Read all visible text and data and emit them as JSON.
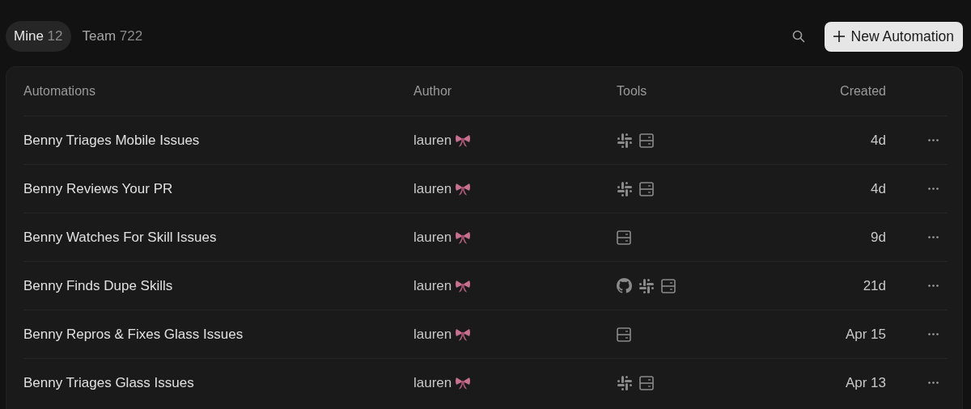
{
  "tabs": [
    {
      "label": "Mine",
      "count": "12",
      "selected": true
    },
    {
      "label": "Team",
      "count": "722",
      "selected": false
    }
  ],
  "new_button": {
    "label": "New Automation"
  },
  "table": {
    "columns": [
      "Automations",
      "Author",
      "Tools",
      "Created"
    ],
    "rows": [
      {
        "name": "Benny Triages Mobile Issues",
        "author": "lauren",
        "tools": [
          {
            "kind": "slack"
          },
          {
            "kind": "server"
          }
        ],
        "created": "4d"
      },
      {
        "name": "Benny Reviews Your PR",
        "author": "lauren",
        "tools": [
          {
            "kind": "slack"
          },
          {
            "kind": "server"
          }
        ],
        "created": "4d"
      },
      {
        "name": "Benny Watches For Skill Issues",
        "author": "lauren",
        "tools": [
          {
            "kind": "server"
          }
        ],
        "created": "9d"
      },
      {
        "name": "Benny Finds Dupe Skills",
        "author": "lauren",
        "tools": [
          {
            "kind": "github"
          },
          {
            "kind": "slack"
          },
          {
            "kind": "server"
          }
        ],
        "created": "21d"
      },
      {
        "name": "Benny Repros & Fixes Glass Issues",
        "author": "lauren",
        "tools": [
          {
            "kind": "server"
          }
        ],
        "created": "Apr 15"
      },
      {
        "name": "Benny Triages Glass Issues",
        "author": "lauren",
        "tools": [
          {
            "kind": "slack"
          },
          {
            "kind": "server"
          }
        ],
        "created": "Apr 13"
      }
    ]
  }
}
